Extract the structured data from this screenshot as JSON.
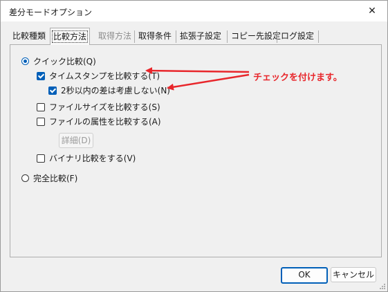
{
  "window": {
    "title": "差分モードオプション"
  },
  "tabs": [
    {
      "label": "比較種類",
      "state": "normal"
    },
    {
      "label": "比較方法",
      "state": "active"
    },
    {
      "label": "取得方法",
      "state": "disabled"
    },
    {
      "label": "取得条件",
      "state": "normal"
    },
    {
      "label": "拡張子設定",
      "state": "normal"
    },
    {
      "label": "コピー先設定",
      "state": "normal"
    },
    {
      "label": "ログ設定",
      "state": "normal"
    }
  ],
  "options": {
    "quick_compare": {
      "label": "クイック比較(Q)",
      "selected": true
    },
    "timestamp": {
      "label": "タイムスタンプを比較する(T)",
      "checked": true
    },
    "ignore_2sec": {
      "label": "2秒以内の差は考慮しない(N)",
      "checked": true
    },
    "filesize": {
      "label": "ファイルサイズを比較する(S)",
      "checked": false
    },
    "attributes": {
      "label": "ファイルの属性を比較する(A)",
      "checked": false
    },
    "details_button": "詳細(D)",
    "binary": {
      "label": "バイナリ比較をする(V)",
      "checked": false
    },
    "full_compare": {
      "label": "完全比較(F)",
      "selected": false
    }
  },
  "annotation": {
    "text": "チェックを付けます。",
    "color": "#e8262b"
  },
  "buttons": {
    "ok": "OK",
    "cancel": "キャンセル"
  },
  "colors": {
    "accent": "#005fb8",
    "window_bg": "#f0f0f0"
  },
  "icons": {
    "close": "close-icon",
    "resize": "resize-grip-icon"
  }
}
